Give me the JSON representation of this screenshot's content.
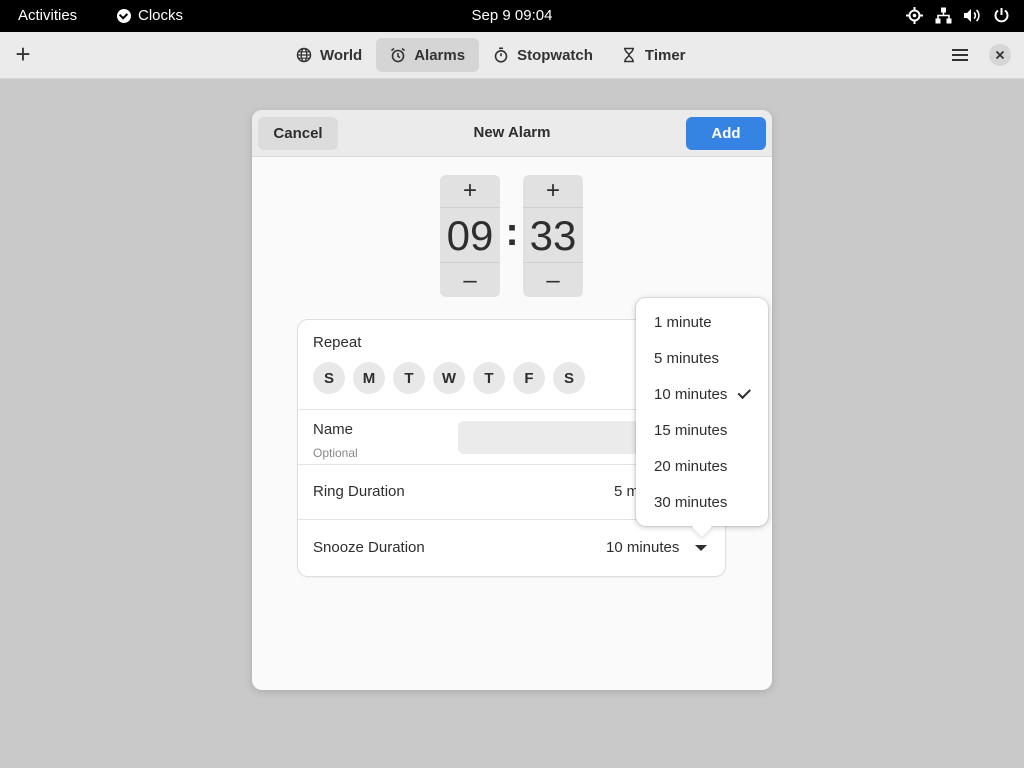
{
  "topbar": {
    "activities": "Activities",
    "app_name": "Clocks",
    "datetime": "Sep 9  09:04"
  },
  "headerbar": {
    "tabs": [
      {
        "label": "World",
        "icon": "globe-icon"
      },
      {
        "label": "Alarms",
        "icon": "alarm-icon"
      },
      {
        "label": "Stopwatch",
        "icon": "stopwatch-icon"
      },
      {
        "label": "Timer",
        "icon": "hourglass-icon"
      }
    ],
    "active_tab": "Alarms"
  },
  "dialog": {
    "title": "New Alarm",
    "cancel_label": "Cancel",
    "add_label": "Add",
    "hour": "09",
    "minute": "33",
    "separator": ":",
    "plus": "+",
    "minus": "–",
    "repeat_label": "Repeat",
    "days": [
      "S",
      "M",
      "T",
      "W",
      "T",
      "F",
      "S"
    ],
    "name_label": "Name",
    "name_sub": "Optional",
    "name_value": "",
    "ring_label": "Ring Duration",
    "ring_value": "5 m",
    "snooze_label": "Snooze Duration",
    "snooze_value": "10 minutes"
  },
  "popover": {
    "items": [
      "1 minute",
      "5 minutes",
      "10 minutes",
      "15 minutes",
      "20 minutes",
      "30 minutes"
    ],
    "selected": "10 minutes"
  },
  "colors": {
    "accent": "#3584e4",
    "topbar": "#000000",
    "background": "#c9c9c9"
  }
}
